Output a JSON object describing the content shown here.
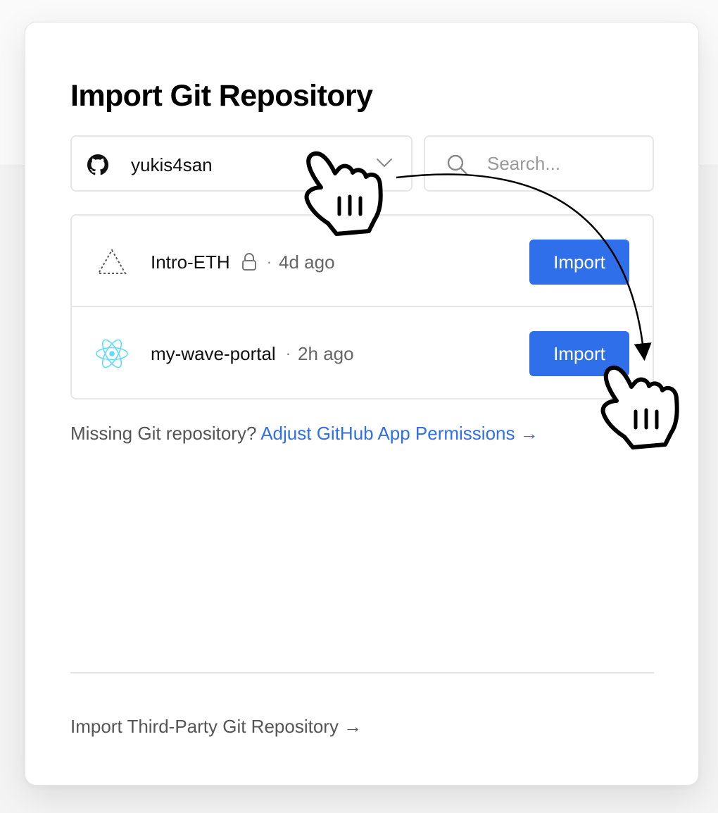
{
  "dialog": {
    "title": "Import Git Repository"
  },
  "account_selector": {
    "account_name": "yukis4san",
    "icon": "github-icon"
  },
  "search": {
    "placeholder": "Search...",
    "value": "",
    "icon": "search-icon"
  },
  "repositories": [
    {
      "name": "Intro-ETH",
      "icon": "triangle-outline-icon",
      "private": true,
      "separator": "·",
      "updated": "4d ago",
      "action_label": "Import"
    },
    {
      "name": "my-wave-portal",
      "icon": "react-atom-icon",
      "private": false,
      "separator": "·",
      "updated": "2h ago",
      "action_label": "Import"
    }
  ],
  "missing_repo": {
    "text": "Missing Git repository? ",
    "link_label": "Adjust GitHub App Permissions →"
  },
  "footer": {
    "third_party_label": "Import Third-Party Git Repository →"
  },
  "colors": {
    "accent": "#2f6fe9",
    "border": "#e6e6e6",
    "react": "#61dafb"
  }
}
